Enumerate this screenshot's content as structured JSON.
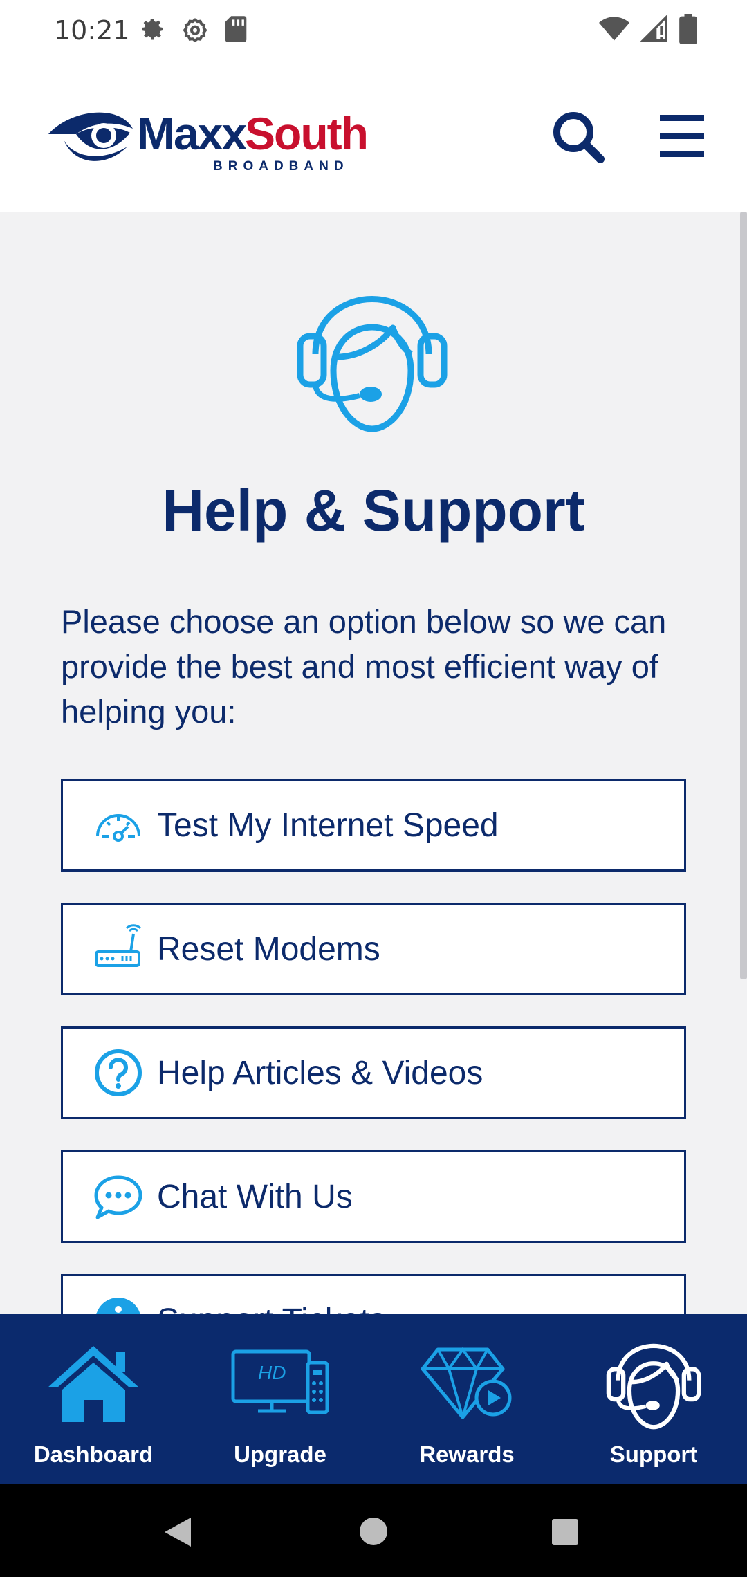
{
  "status_bar": {
    "time": "10:21",
    "left_icons": [
      "gear-icon",
      "settings-cog-icon",
      "sd-card-icon"
    ],
    "right_icons": [
      "wifi-icon",
      "cell-signal-icon",
      "battery-icon"
    ]
  },
  "header": {
    "logo_primary": "Maxx",
    "logo_accent": "South",
    "logo_sub": "BROADBAND",
    "search_icon": "search-icon",
    "menu_icon": "hamburger-menu-icon"
  },
  "main": {
    "hero_icon": "support-agent-headset-icon",
    "title": "Help & Support",
    "intro": "Please choose an option below so we can provide the best and most efficient way of helping you:",
    "options": [
      {
        "label": "Test My Internet Speed",
        "icon": "speedometer-icon"
      },
      {
        "label": "Reset Modems",
        "icon": "modem-icon"
      },
      {
        "label": "Help Articles & Videos",
        "icon": "question-circle-icon"
      },
      {
        "label": "Chat With Us",
        "icon": "chat-bubble-icon"
      },
      {
        "label": "Support Tickets",
        "icon": "info-circle-icon"
      }
    ]
  },
  "bottom_nav": {
    "items": [
      {
        "label": "Dashboard",
        "icon": "house-icon",
        "active": false
      },
      {
        "label": "Upgrade",
        "icon": "hd-tv-remote-icon",
        "active": false
      },
      {
        "label": "Rewards",
        "icon": "diamond-play-icon",
        "active": false
      },
      {
        "label": "Support",
        "icon": "support-agent-headset-icon",
        "active": true
      }
    ]
  },
  "colors": {
    "navy": "#0c2a6b",
    "accent_blue": "#1ba1e6",
    "brand_red": "#c8102e",
    "background": "#f2f2f3"
  }
}
